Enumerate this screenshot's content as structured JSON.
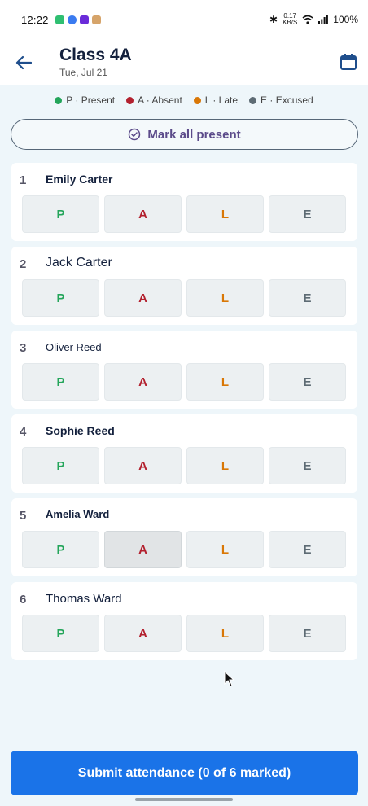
{
  "status_bar": {
    "time": "12:22",
    "speed_value": "0.17",
    "speed_unit": "KB/S",
    "battery": "100%"
  },
  "header": {
    "title": "Class 4A",
    "date": "Tue, Jul 21"
  },
  "legend": [
    {
      "label": "P · Present",
      "color": "#23a55a"
    },
    {
      "label": "A · Absent",
      "color": "#b3212f"
    },
    {
      "label": "L · Late",
      "color": "#d97706"
    },
    {
      "label": "E · Excused",
      "color": "#5d6b74"
    }
  ],
  "mark_all": {
    "label": "Mark all present"
  },
  "buttons": {
    "p": "P",
    "a": "A",
    "l": "L",
    "e": "E"
  },
  "students": [
    {
      "num": "1",
      "name": "Emily Carter"
    },
    {
      "num": "2",
      "name": "Jack Carter"
    },
    {
      "num": "3",
      "name": "Oliver Reed"
    },
    {
      "num": "4",
      "name": "Sophie Reed"
    },
    {
      "num": "5",
      "name": "Amelia Ward"
    },
    {
      "num": "6",
      "name": "Thomas Ward"
    }
  ],
  "submit": {
    "label": "Submit attendance (0 of 6 marked)"
  }
}
